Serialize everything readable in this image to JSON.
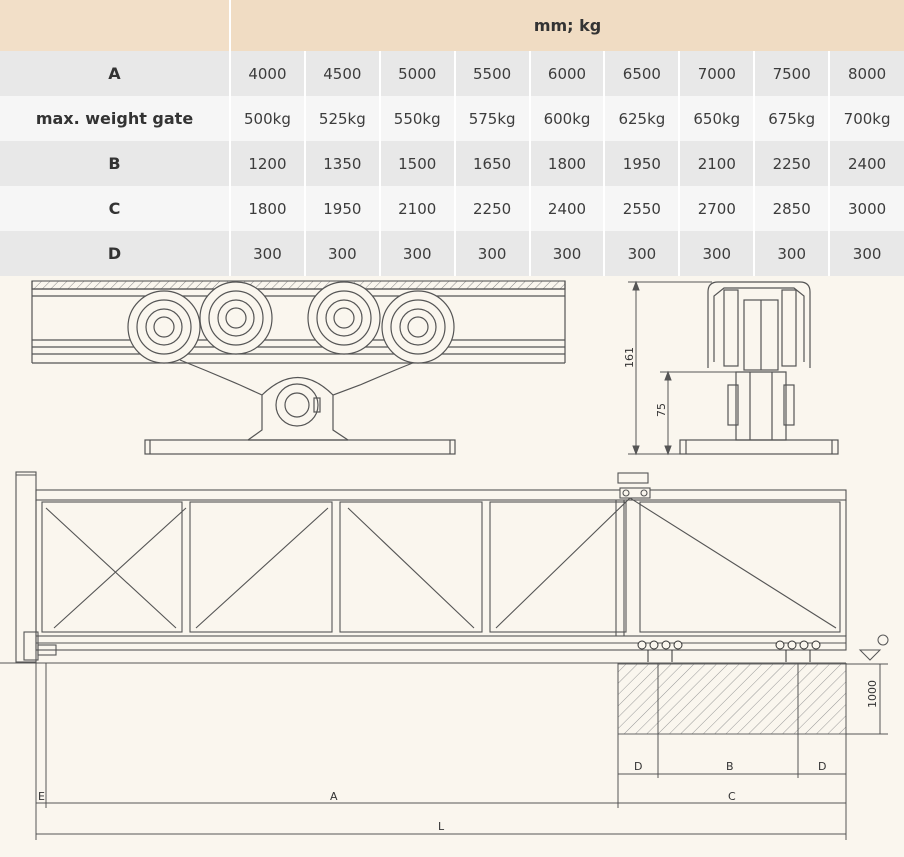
{
  "table": {
    "header": "mm; kg",
    "rows": [
      {
        "label": "A",
        "values": [
          "4000",
          "4500",
          "5000",
          "5500",
          "6000",
          "6500",
          "7000",
          "7500",
          "8000"
        ]
      },
      {
        "label": "max. weight gate",
        "values": [
          "500kg",
          "525kg",
          "550kg",
          "575kg",
          "600kg",
          "625kg",
          "650kg",
          "675kg",
          "700kg"
        ]
      },
      {
        "label": "B",
        "values": [
          "1200",
          "1350",
          "1500",
          "1650",
          "1800",
          "1950",
          "2100",
          "2250",
          "2400"
        ]
      },
      {
        "label": "C",
        "values": [
          "1800",
          "1950",
          "2100",
          "2250",
          "2400",
          "2550",
          "2700",
          "2850",
          "3000"
        ]
      },
      {
        "label": "D",
        "values": [
          "300",
          "300",
          "300",
          "300",
          "300",
          "300",
          "300",
          "300",
          "300"
        ]
      }
    ]
  },
  "drawing": {
    "side_view_dims": {
      "total_height": "161",
      "axle_height": "75"
    },
    "gate_dims": {
      "counterweight_height": "1000",
      "label_A": "A",
      "label_B": "B",
      "label_C": "C",
      "label_D_left": "D",
      "label_D_right": "D",
      "label_E": "E",
      "label_L": "L"
    }
  }
}
